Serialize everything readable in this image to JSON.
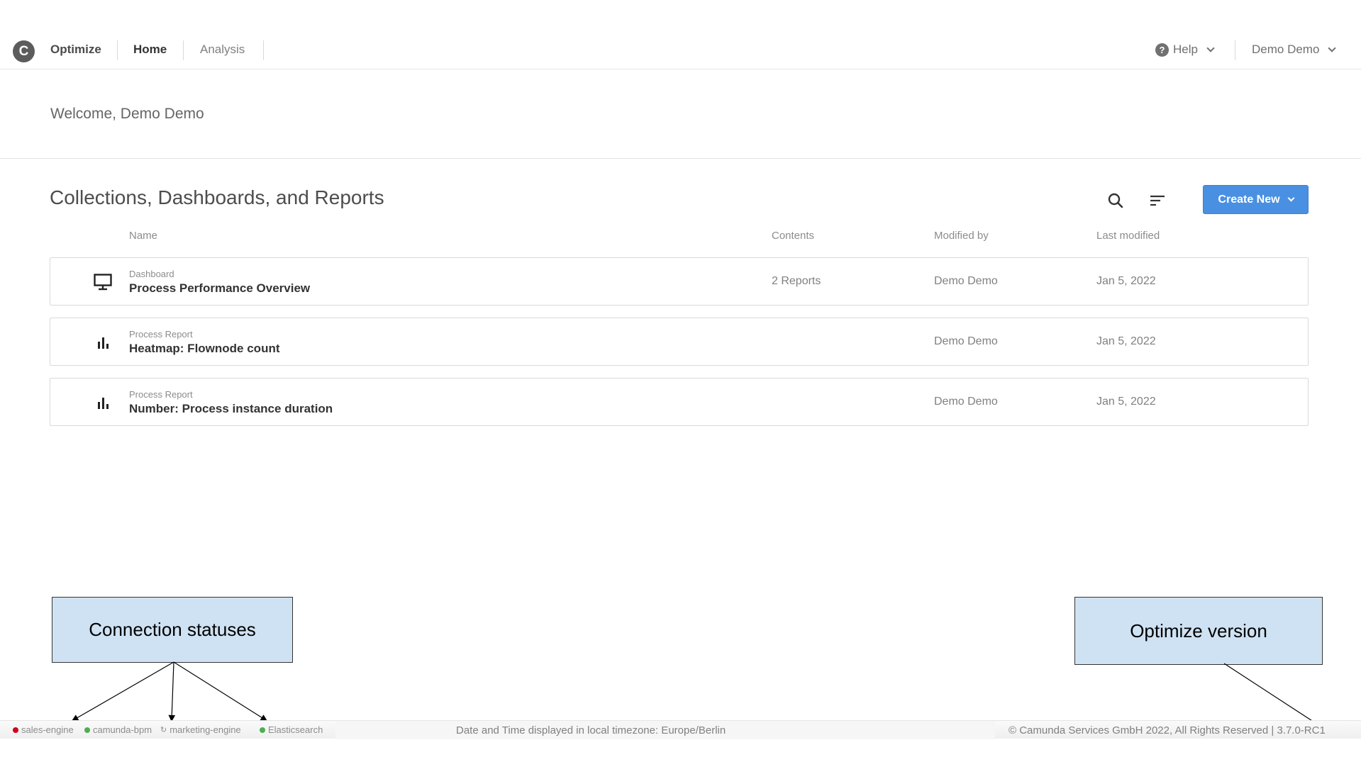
{
  "header": {
    "logo_letter": "C",
    "brand": "Optimize",
    "nav": [
      {
        "label": "Home",
        "active": true
      },
      {
        "label": "Analysis",
        "active": false
      }
    ],
    "help_label": "Help",
    "user_label": "Demo Demo"
  },
  "welcome": "Welcome, Demo Demo",
  "section": {
    "title": "Collections, Dashboards, and Reports",
    "create_label": "Create New",
    "search_icon": "search-icon",
    "sort_icon": "sort-icon"
  },
  "columns": {
    "name": "Name",
    "contents": "Contents",
    "modified_by": "Modified by",
    "last_modified": "Last modified"
  },
  "rows": [
    {
      "icon": "monitor-icon",
      "type": "Dashboard",
      "name": "Process Performance Overview",
      "contents": "2 Reports",
      "modified_by": "Demo Demo",
      "last_modified": "Jan 5, 2022"
    },
    {
      "icon": "bar-chart-icon",
      "type": "Process Report",
      "name": "Heatmap: Flownode count",
      "contents": "",
      "modified_by": "Demo Demo",
      "last_modified": "Jan 5, 2022"
    },
    {
      "icon": "bar-chart-icon",
      "type": "Process Report",
      "name": "Number: Process instance duration",
      "contents": "",
      "modified_by": "Demo Demo",
      "last_modified": "Jan 5, 2022"
    }
  ],
  "annotations": {
    "connection": "Connection statuses",
    "version": "Optimize version"
  },
  "footer": {
    "statuses": [
      {
        "label": "sales-engine",
        "color": "#d0021b"
      },
      {
        "label": "camunda-bpm",
        "color": "#4caf50"
      },
      {
        "label": "marketing-engine",
        "color": "#9e9e9e"
      },
      {
        "label": "Elasticsearch",
        "color": "#4caf50"
      }
    ],
    "timezone": "Date and Time displayed in local timezone: Europe/Berlin",
    "copyright": "© Camunda Services GmbH 2022, All Rights Reserved | 3.7.0-RC1"
  },
  "colors": {
    "primary": "#4a90e2",
    "annotation_bg": "#cfe2f3"
  }
}
